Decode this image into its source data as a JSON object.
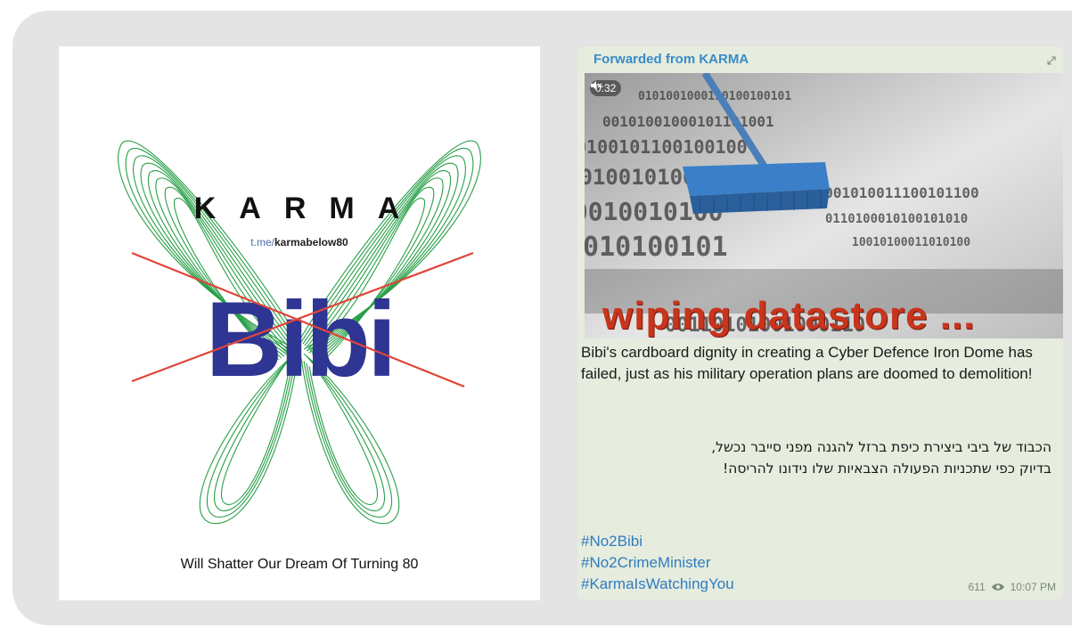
{
  "logo": {
    "title": "KARMA",
    "link_prefix": "t.me/",
    "link_handle": "karmabelow80",
    "big_text": "Bibi",
    "tagline": "Will Shatter Our Dream Of Turning 80",
    "colors": {
      "wings": "#1e9a3e",
      "bibi": "#2e3592",
      "cross": "#e0453a"
    }
  },
  "message": {
    "forwarded_label": "Forwarded from KARMA",
    "video": {
      "duration": "0:32",
      "mute_icon": "speaker-muted-icon",
      "overlay_text": "wiping datastore ..."
    },
    "text_en": "Bibi's cardboard dignity in creating a Cyber Defence Iron Dome has failed, just as his military operation plans are doomed to demolition!",
    "text_he_line1": "הכבוד של ביבי ביצירת כיפת ברזל להגנה מפני סייבר נכשל,",
    "text_he_line2": "בדיוק כפי שתכניות הפעולה הצבאיות שלו נידונו להריסה!",
    "hashtags": [
      "#No2Bibi",
      "#No2CrimeMinister",
      "#KarmaIsWatchingYou"
    ],
    "views": "611",
    "time": "10:07 PM",
    "colors": {
      "accent": "#3a8bc8",
      "bubble": "#e6ecde"
    }
  }
}
